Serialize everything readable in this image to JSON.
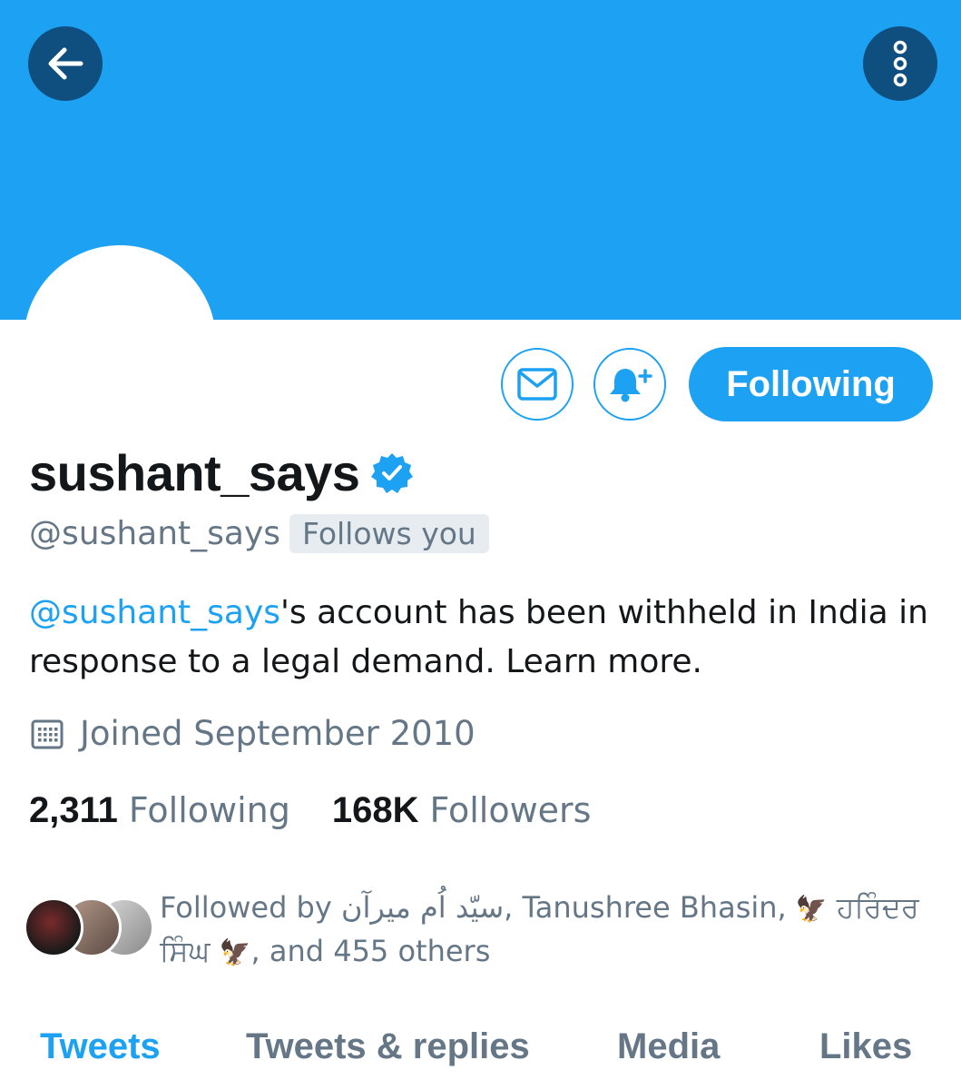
{
  "header": {
    "banner_color": "#1da1f2",
    "back_icon": "arrow-left-icon",
    "more_icon": "more-vertical-icon"
  },
  "actions": {
    "message_icon": "envelope-icon",
    "notify_icon": "bell-plus-icon",
    "follow_label": "Following"
  },
  "profile": {
    "display_name": "sushant_says",
    "verified_icon": "verified-badge-icon",
    "handle": "@sushant_says",
    "follows_you": "Follows you",
    "bio_mention": "@sushant_says",
    "bio_text": "'s account has been withheld in India in response to a legal demand. Learn more.",
    "joined_icon": "calendar-icon",
    "joined": "Joined September 2010"
  },
  "stats": {
    "following_count": "2,311",
    "following_label": "Following",
    "followers_count": "168K",
    "followers_label": "Followers"
  },
  "followed_by": {
    "prefix": "Followed by ",
    "name1": "سیّد اُم میرآن",
    "sep1": ", Tanushree Bhasin, ",
    "name3": "ਹਰਿੰਦਰ ਸਿੰਘ",
    "suffix": ", and 455 others"
  },
  "tabs": [
    {
      "label": "Tweets",
      "active": true
    },
    {
      "label": "Tweets & replies",
      "active": false
    },
    {
      "label": "Media",
      "active": false
    },
    {
      "label": "Likes",
      "active": false
    }
  ]
}
